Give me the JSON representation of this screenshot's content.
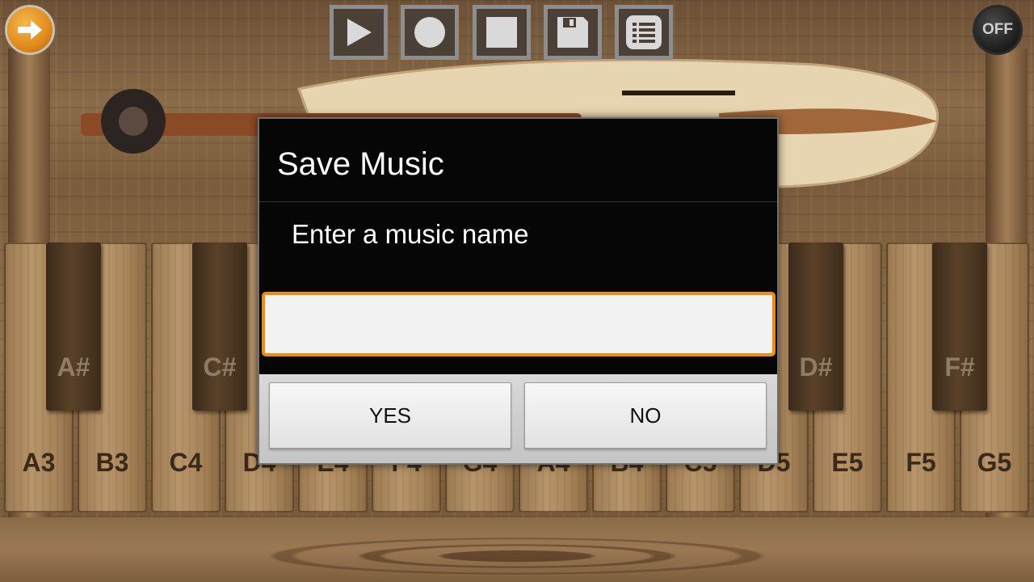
{
  "toolbar": {
    "arrow_icon": "arrow-right-icon",
    "play_icon": "play-icon",
    "record_icon": "record-icon",
    "stop_icon": "stop-icon",
    "save_icon": "floppy-save-icon",
    "list_icon": "list-icon",
    "power_label": "OFF"
  },
  "keyboard": {
    "white_keys": [
      "A3",
      "B3",
      "C4",
      "D4",
      "E4",
      "F4",
      "G4",
      "A4",
      "B4",
      "C5",
      "D5",
      "E5",
      "F5",
      "G5"
    ],
    "black_keys_visible": [
      "A#",
      "C#",
      "D#",
      "F#"
    ]
  },
  "dialog": {
    "title": "Save Music",
    "message": "Enter a music name",
    "input_value": "",
    "yes_label": "YES",
    "no_label": "NO"
  },
  "colors": {
    "accent": "#f08a10",
    "dialog_bg": "#060606"
  }
}
